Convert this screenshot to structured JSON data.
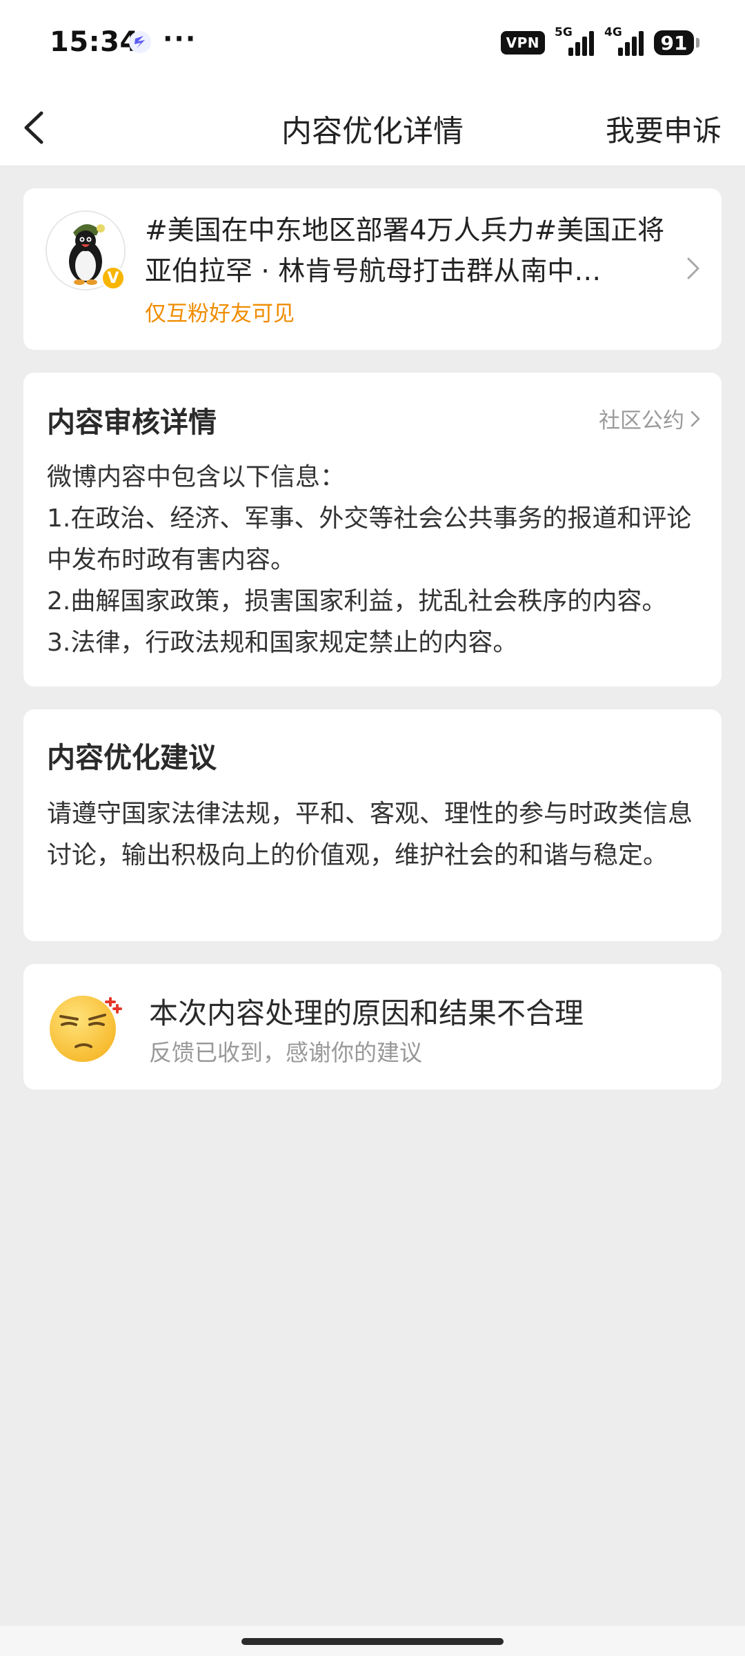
{
  "status_bar": {
    "time": "15:34",
    "more": "···",
    "vpn": "VPN",
    "signal_1": "5G",
    "signal_2": "4G",
    "battery": "91",
    "icons": [
      "app-notification-icon",
      "signal-5g-icon",
      "signal-4g-icon",
      "battery-icon"
    ]
  },
  "header": {
    "title": "内容优化详情",
    "appeal_label": "我要申诉",
    "back_icon": "chevron-left-icon"
  },
  "post": {
    "text": "#美国在中东地区部署4万人兵力#美国正将亚伯拉罕 · 林肯号航母打击群从南中…",
    "visibility": "仅互粉好友可见",
    "verified": "V",
    "avatar": "penguin-avatar",
    "chevron_icon": "chevron-right-icon"
  },
  "review": {
    "title": "内容审核详情",
    "guideline_link": "社区公约",
    "intro": "微博内容中包含以下信息：",
    "items": [
      "1.在政治、经济、军事、外交等社会公共事务的报道和评论中发布时政有害内容。",
      "2.曲解国家政策，损害国家利益，扰乱社会秩序的内容。",
      "3.法律，行政法规和国家规定禁止的内容。"
    ]
  },
  "suggestion": {
    "title": "内容优化建议",
    "body": "请遵守国家法律法规，平和、客观、理性的参与时政类信息讨论，输出积极向上的价值观，维护社会的和谐与稳定。"
  },
  "feedback": {
    "title": "本次内容处理的原因和结果不合理",
    "subtitle": "反馈已收到，感谢你的建议",
    "emoji": "annoyed-face-emoji"
  },
  "colors": {
    "background": "#ededed",
    "card": "#ffffff",
    "accent_orange": "#f08c00",
    "verified_yellow": "#f7b500",
    "secondary_text": "#999999"
  }
}
